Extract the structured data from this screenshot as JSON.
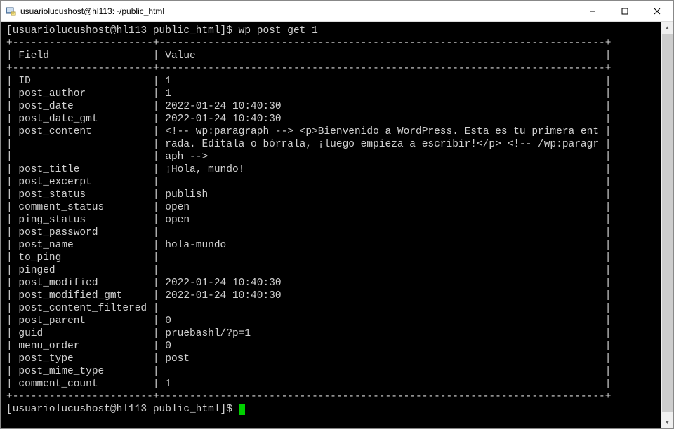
{
  "window": {
    "title": "usuariolucushost@hl113:~/public_html"
  },
  "prompt": {
    "text": "[usuariolucushost@hl113 public_html]$"
  },
  "command": "wp post get 1",
  "table": {
    "header": {
      "field": "Field",
      "value": "Value"
    },
    "rows": [
      {
        "field": "ID",
        "value": "1"
      },
      {
        "field": "post_author",
        "value": "1"
      },
      {
        "field": "post_date",
        "value": "2022-01-24 10:40:30"
      },
      {
        "field": "post_date_gmt",
        "value": "2022-01-24 10:40:30"
      },
      {
        "field": "post_content",
        "value": "<!-- wp:paragraph --> <p>Bienvenido a WordPress. Esta es tu primera entrada. Edítala o bórrala, ¡luego empieza a escribir!</p> <!-- /wp:paragraph -->"
      },
      {
        "field": "post_title",
        "value": "¡Hola, mundo!"
      },
      {
        "field": "post_excerpt",
        "value": ""
      },
      {
        "field": "post_status",
        "value": "publish"
      },
      {
        "field": "comment_status",
        "value": "open"
      },
      {
        "field": "ping_status",
        "value": "open"
      },
      {
        "field": "post_password",
        "value": ""
      },
      {
        "field": "post_name",
        "value": "hola-mundo"
      },
      {
        "field": "to_ping",
        "value": ""
      },
      {
        "field": "pinged",
        "value": ""
      },
      {
        "field": "post_modified",
        "value": "2022-01-24 10:40:30"
      },
      {
        "field": "post_modified_gmt",
        "value": "2022-01-24 10:40:30"
      },
      {
        "field": "post_content_filtered",
        "value": ""
      },
      {
        "field": "post_parent",
        "value": "0"
      },
      {
        "field": "guid",
        "value": "pruebashl/?p=1"
      },
      {
        "field": "menu_order",
        "value": "0"
      },
      {
        "field": "post_type",
        "value": "post"
      },
      {
        "field": "post_mime_type",
        "value": ""
      },
      {
        "field": "comment_count",
        "value": "1"
      }
    ]
  },
  "layout": {
    "fieldCol": 23,
    "totalWidth": 99,
    "valueCol": 72
  }
}
